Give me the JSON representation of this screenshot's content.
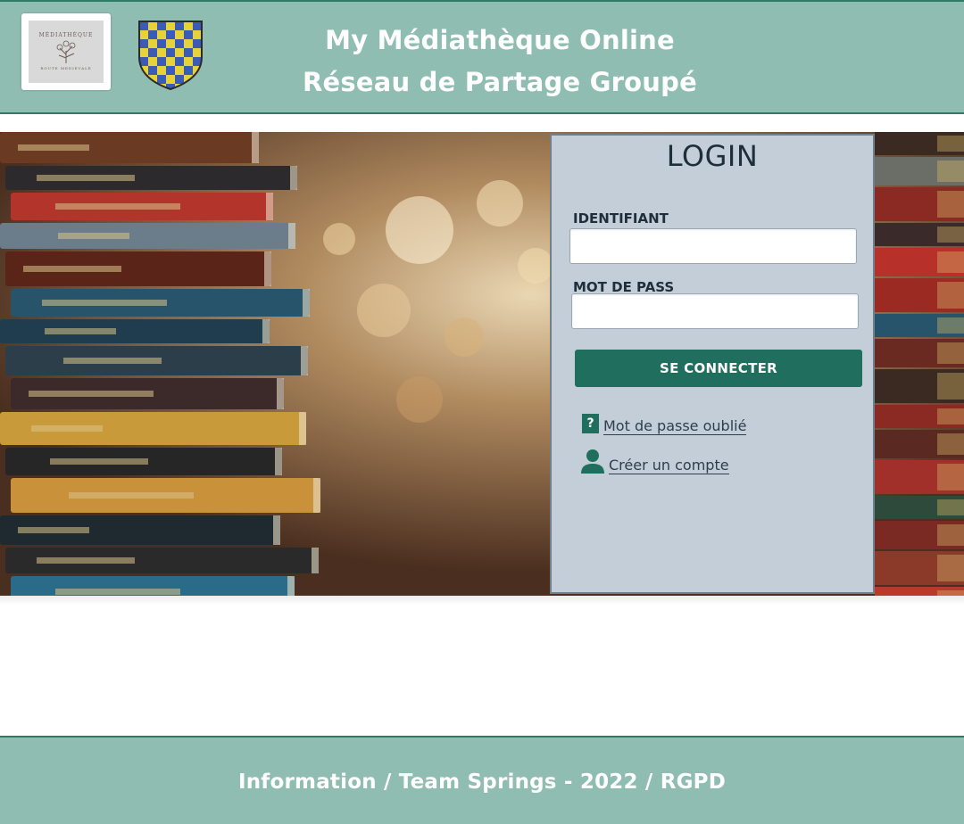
{
  "header": {
    "logo_text": [
      "MÉDIATHÈQUE",
      "ROUTE MEDIEVALE"
    ],
    "title_line1": "My Médiathèque Online",
    "title_line2": "Réseau de Partage Groupé",
    "colors": {
      "bar": "#8fbdb1",
      "border": "#2f7a67"
    }
  },
  "hero": {
    "background": "library-books-photo"
  },
  "login": {
    "title": "LOGIN",
    "identifiant_label": "IDENTIFIANT",
    "identifiant_value": "",
    "password_label": "MOT DE PASS",
    "password_value": "",
    "connect_label": "SE CONNECTER",
    "forgot_icon": "question-icon",
    "forgot_label": "Mot de passe oublié",
    "create_icon": "user-icon",
    "create_label": "Créer un compte",
    "colors": {
      "panel": "#c4ced8",
      "button": "#1f6e5e"
    }
  },
  "footer": {
    "text": "Information / Team Springs - 2022 / RGPD"
  }
}
